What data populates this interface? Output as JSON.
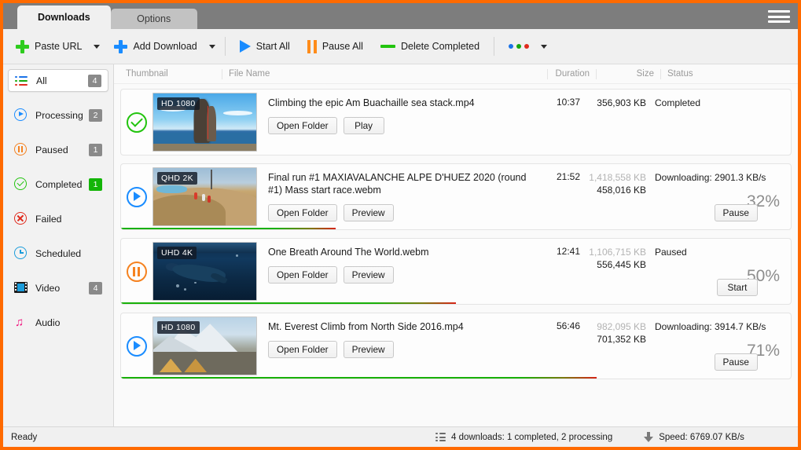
{
  "window": {
    "accent_color": "#ff6a00",
    "tabs": [
      {
        "label": "Downloads",
        "active": true
      },
      {
        "label": "Options",
        "active": false
      }
    ],
    "menu_icon": "hamburger-menu-icon"
  },
  "toolbar": {
    "paste_url": "Paste URL",
    "add_download": "Add Download",
    "start_all": "Start All",
    "pause_all": "Pause All",
    "delete_completed": "Delete Completed",
    "more_icon": "three-colored-dots-icon"
  },
  "sidebar": {
    "items": [
      {
        "label": "All",
        "badge": "4",
        "icon": "all-list-icon",
        "selected": true,
        "badge_color": "#8a8a8a"
      },
      {
        "label": "Processing",
        "badge": "2",
        "icon": "play-circle-icon",
        "selected": false,
        "badge_color": "#8a8a8a"
      },
      {
        "label": "Paused",
        "badge": "1",
        "icon": "pause-circle-icon",
        "selected": false,
        "badge_color": "#8a8a8a"
      },
      {
        "label": "Completed",
        "badge": "1",
        "icon": "check-circle-icon",
        "selected": false,
        "badge_color": "#13b508"
      },
      {
        "label": "Failed",
        "badge": "",
        "icon": "x-circle-icon",
        "selected": false,
        "badge_color": ""
      },
      {
        "label": "Scheduled",
        "badge": "",
        "icon": "clock-icon",
        "selected": false,
        "badge_color": ""
      },
      {
        "label": "Video",
        "badge": "4",
        "icon": "film-strip-icon",
        "selected": false,
        "badge_color": "#8a8a8a"
      },
      {
        "label": "Audio",
        "badge": "",
        "icon": "music-note-icon",
        "selected": false,
        "badge_color": ""
      }
    ]
  },
  "columns": {
    "thumbnail": "Thumbnail",
    "file_name": "File Name",
    "duration": "Duration",
    "size": "Size",
    "status": "Status"
  },
  "downloads": [
    {
      "state_icon": "check-circle-icon",
      "quality": "HD 1080",
      "file_name": "Climbing the epic Am Buachaille sea stack.mp4",
      "buttons": [
        "Open Folder",
        "Play"
      ],
      "duration": "10:37",
      "size_total": "",
      "size_done": "356,903 KB",
      "status": "Completed",
      "percent": "",
      "progress": 100,
      "action_button": "",
      "show_progress_bar": false
    },
    {
      "state_icon": "play-circle-icon",
      "quality": "QHD 2K",
      "file_name": "Final run #1  MAXIAVALANCHE ALPE D'HUEZ 2020 (round #1) Mass start race.webm",
      "buttons": [
        "Open Folder",
        "Preview"
      ],
      "duration": "21:52",
      "size_total": "1,418,558 KB",
      "size_done": "458,016 KB",
      "status": "Downloading: 2901.3 KB/s",
      "percent": "32%",
      "progress": 32,
      "action_button": "Pause",
      "show_progress_bar": true
    },
    {
      "state_icon": "pause-circle-icon",
      "quality": "UHD 4K",
      "file_name": "One Breath Around The World.webm",
      "buttons": [
        "Open Folder",
        "Preview"
      ],
      "duration": "12:41",
      "size_total": "1,106,715 KB",
      "size_done": "556,445 KB",
      "status": "Paused",
      "percent": "50%",
      "progress": 50,
      "action_button": "Start",
      "show_progress_bar": true
    },
    {
      "state_icon": "play-circle-icon",
      "quality": "HD 1080",
      "file_name": "Mt. Everest Climb from North Side 2016.mp4",
      "buttons": [
        "Open Folder",
        "Preview"
      ],
      "duration": "56:46",
      "size_total": "982,095 KB",
      "size_done": "701,352 KB",
      "status": "Downloading: 3914.7 KB/s",
      "percent": "71%",
      "progress": 71,
      "action_button": "Pause",
      "show_progress_bar": true
    }
  ],
  "statusbar": {
    "ready": "Ready",
    "counts": "4 downloads: 1 completed, 2 processing",
    "speed": "Speed: 6769.07 KB/s",
    "counts_icon": "list-icon",
    "speed_icon": "download-arrow-icon"
  }
}
